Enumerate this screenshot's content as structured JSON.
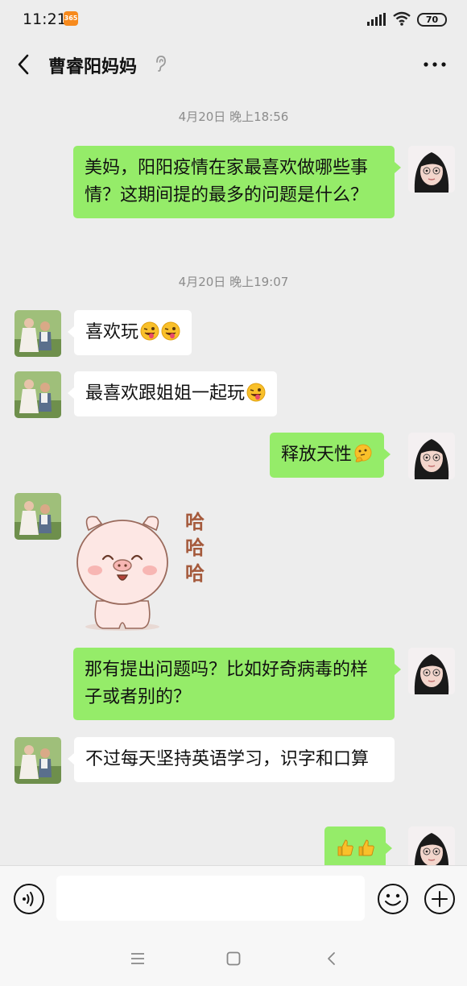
{
  "status_bar": {
    "time": "11:21",
    "app_badge": "365",
    "battery": "70"
  },
  "header": {
    "title": "曹睿阳妈妈"
  },
  "messages": [
    {
      "type": "timestamp",
      "text": "4月20日 晚上18:56"
    },
    {
      "type": "out",
      "text": "美妈，阳阳疫情在家最喜欢做哪些事情？这期间提的最多的问题是什么？"
    },
    {
      "type": "timestamp",
      "text": "4月20日 晚上19:07"
    },
    {
      "type": "in",
      "text": "喜欢玩",
      "emojis": [
        "tongue-wink-emoji",
        "tongue-wink-emoji"
      ]
    },
    {
      "type": "in",
      "text": "最喜欢跟姐姐一起玩",
      "emojis": [
        "tongue-wink-emoji"
      ]
    },
    {
      "type": "out",
      "text": "释放天性",
      "emojis": [
        "thinking-emoji"
      ]
    },
    {
      "type": "in",
      "sticker": "pig-laughing-sticker",
      "sticker_text": [
        "哈",
        "哈",
        "哈"
      ]
    },
    {
      "type": "out",
      "text": "那有提出问题吗？比如好奇病毒的样子或者别的？"
    },
    {
      "type": "in",
      "text": "不过每天坚持英语学习，识字和口算"
    },
    {
      "type": "out",
      "text": "",
      "emojis": [
        "thumbs-up-emoji",
        "thumbs-up-emoji"
      ]
    }
  ],
  "input": {
    "value": ""
  },
  "colors": {
    "background": "#ededed",
    "outgoing_bubble": "#95ec69",
    "incoming_bubble": "#ffffff"
  }
}
